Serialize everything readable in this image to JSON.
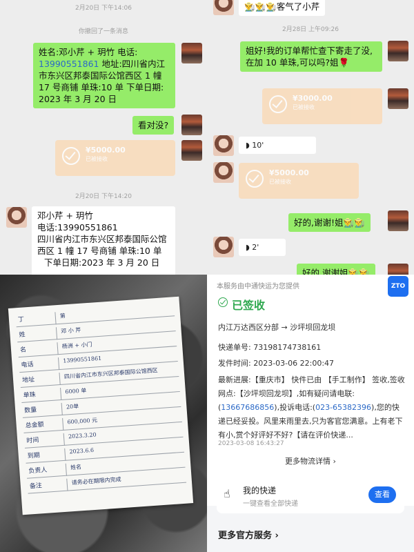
{
  "chat_left": {
    "timestamp_top": "2月20日 下午14:06",
    "recall_notice": "你撤回了一条消息",
    "order_message": {
      "name_prefix": "姓名:邓小芹 + 玥竹",
      "phone_label": "电话:",
      "phone": "13990551861",
      "address_line": "地址:四川省内江市东兴区邦泰国际公馆西区 1 幢 17 号商铺",
      "beads": "单珠:10 单",
      "order_date": "下单日期: 2023 年 3 月 20 日"
    },
    "check_message": "看对没?",
    "transfer_amount": "¥5000.00",
    "transfer_status": "已被接收",
    "timestamp_mid": "2月20日 下午14:20",
    "reply_message": {
      "line1": "邓小芹 + 玥竹",
      "phone_label": "电话:",
      "phone": "13990551861",
      "address": "四川省内江市东兴区邦泰国际公馆西区 1 幢 17 号商铺",
      "beads": "单珠:10 单",
      "order_date": "下单日期:2023 年 3 月 20 日"
    }
  },
  "chat_right": {
    "thanks_top": "👨‍🌾👨‍🌾👨‍🌾客气了小芹",
    "timestamp": "2月28日 上午09:26",
    "request_message": "姐好!我的订单帮忙查下寄走了没,在加 10 单珠,可以吗?姐🌹",
    "transfer1_amount": "¥3000.00",
    "transfer1_status": "已被接收",
    "voice1": "10'",
    "transfer2_amount": "¥5000.00",
    "transfer2_status": "已被接收",
    "ok_message": "好的,谢谢!姐👨‍🌾👨‍🌾",
    "voice2": "2'",
    "bottom_message": "好的,谢谢姐👨‍🌾👨‍🌾"
  },
  "paper": {
    "rows": [
      {
        "label": "丁",
        "value": "第"
      },
      {
        "label": "姓",
        "value": "邓 小 芹"
      },
      {
        "label": "名",
        "value": "杨洲 + 小门"
      },
      {
        "label": "电话",
        "value": "13990551861"
      },
      {
        "label": "地址",
        "value": "四川省内江市东兴区邦泰国际公馆西区"
      },
      {
        "label": "单珠",
        "value": "6000 单"
      },
      {
        "label": "数量",
        "value": "20单"
      },
      {
        "label": "总金额",
        "value": "600,000 元"
      },
      {
        "label": "时间",
        "value": "2023.3.20"
      },
      {
        "label": "到期",
        "value": "2023.6.6"
      },
      {
        "label": "负责人",
        "value": "姓名"
      },
      {
        "label": "备注",
        "value": "请务必在期限内完成"
      }
    ]
  },
  "logistics": {
    "provider_note": "本服务由中通快运为您提供",
    "status": "已签收",
    "route_from": "内江万达西区分部",
    "route_arrow": "→",
    "route_to": "沙坪坝回龙坝",
    "tracking_label": "快递单号:",
    "tracking_number": "73198174738161",
    "send_time_label": "发件时间:",
    "send_time": "2023-03-06 22:00:47",
    "progress_label": "最新进展:",
    "progress_city": "【重庆市】",
    "progress_text1": "快件已由",
    "progress_tag": "【手工制作】",
    "progress_text2": "签收,签收网点:",
    "progress_site": "【沙坪坝回龙坝】",
    "progress_text3": ",如有疑问请电联:",
    "phone1": "13667686856",
    "complaint_label": ",投诉电话:",
    "phone2": "023-65382396",
    "progress_text4": ",您的快递已经妥投。风里来雨里去,只为客官您满意。上有老下有小,赏个好评好不好?【请在评价快递...",
    "progress_time": "2023-03-08 16:43:27",
    "more_logistics": "更多物流详情",
    "my_express_title": "我的快递",
    "my_express_sub": "一键查看全部快递",
    "view_button": "查看",
    "more_services": "更多官方服务",
    "logo_text": "ZTO"
  },
  "colors": {
    "green_bubble": "#95ec69",
    "chat_bg": "#ededed",
    "transfer_bg": "#fbd9b4",
    "status_green": "#2fa84f",
    "link_blue": "#2b69c7",
    "button_blue": "#1e6ff0"
  }
}
